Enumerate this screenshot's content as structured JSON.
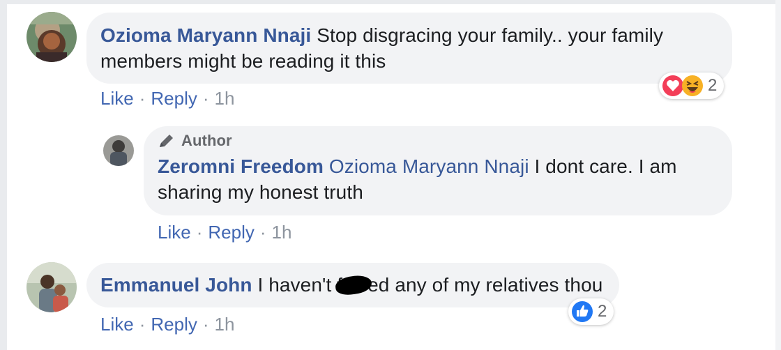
{
  "comments": [
    {
      "author": "Ozioma Maryann Nnaji",
      "text_line1": "Stop disgracing your family.. your family",
      "text_line2": "members might be reading it this",
      "actions": {
        "like": "Like",
        "reply": "Reply",
        "time": "1h",
        "sep": "·"
      },
      "reactions": {
        "icons": [
          "love-reaction",
          "haha-reaction"
        ],
        "count": "2"
      }
    },
    {
      "badge": "Author",
      "author": "Zeromni Freedom",
      "mention": "Ozioma Maryann Nnaji",
      "text_line1": "I dont care. I am",
      "text_line2": "sharing my honest truth",
      "actions": {
        "like": "Like",
        "reply": "Reply",
        "time": "1h",
        "sep": "·"
      }
    },
    {
      "author": "Emmanuel John",
      "text_before": "I haven't f",
      "text_after": "ed any of my relatives thou",
      "actions": {
        "like": "Like",
        "reply": "Reply",
        "time": "1h",
        "sep": "·"
      },
      "reactions": {
        "icons": [
          "like-reaction"
        ],
        "count": "2"
      }
    }
  ],
  "colors": {
    "name": "#385898",
    "link": "#4267b2",
    "meta": "#8d949e",
    "bubble": "#f2f3f5"
  }
}
